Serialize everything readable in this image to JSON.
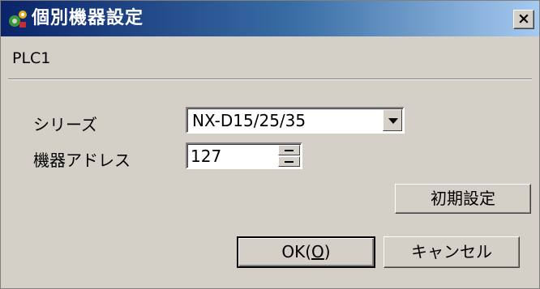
{
  "window": {
    "title": "個別機器設定",
    "close_label": "×"
  },
  "device_name": "PLC1",
  "form": {
    "series_label": "シリーズ",
    "series_value": "NX-D15/25/35",
    "address_label": "機器アドレス",
    "address_value": "127"
  },
  "buttons": {
    "initial_settings": "初期設定",
    "ok_prefix": "OK(",
    "ok_mnemonic": "O",
    "ok_suffix": ")",
    "cancel": "キャンセル"
  },
  "colors": {
    "titlebar_start": "#0a246a",
    "titlebar_end": "#a6caf0",
    "face": "#d4d0c8"
  }
}
